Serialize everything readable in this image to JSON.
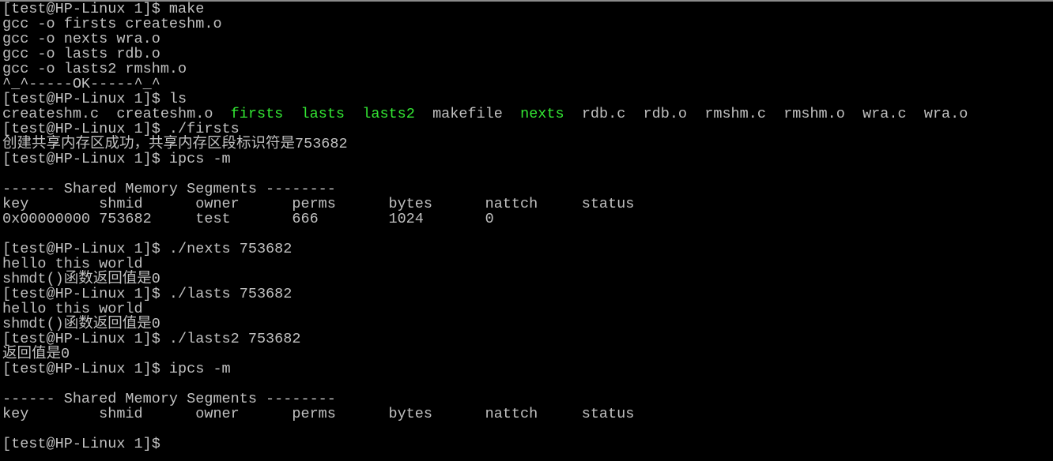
{
  "colors": {
    "background": "#000000",
    "text": "#c0c0c0",
    "executable": "#33e633"
  },
  "terminal": {
    "lines": [
      [
        {
          "t": "[test@HP-Linux 1]$ make"
        }
      ],
      [
        {
          "t": "gcc -o firsts createshm.o"
        }
      ],
      [
        {
          "t": "gcc -o nexts wra.o"
        }
      ],
      [
        {
          "t": "gcc -o lasts rdb.o"
        }
      ],
      [
        {
          "t": "gcc -o lasts2 rmshm.o"
        }
      ],
      [
        {
          "t": "^_^-----OK-----^_^"
        }
      ],
      [
        {
          "t": "[test@HP-Linux 1]$ ls"
        }
      ],
      [
        {
          "t": "createshm.c  createshm.o  "
        },
        {
          "t": "firsts",
          "c": "green"
        },
        {
          "t": "  "
        },
        {
          "t": "lasts",
          "c": "green"
        },
        {
          "t": "  "
        },
        {
          "t": "lasts2",
          "c": "green"
        },
        {
          "t": "  makefile  "
        },
        {
          "t": "nexts",
          "c": "green"
        },
        {
          "t": "  rdb.c  rdb.o  rmshm.c  rmshm.o  wra.c  wra.o"
        }
      ],
      [
        {
          "t": "[test@HP-Linux 1]$ ./firsts"
        }
      ],
      [
        {
          "t": "创建共享内存区成功，共享内存区段标识符是753682"
        }
      ],
      [
        {
          "t": "[test@HP-Linux 1]$ ipcs -m"
        }
      ],
      [
        {
          "t": ""
        }
      ],
      [
        {
          "t": "------ Shared Memory Segments --------"
        }
      ],
      [
        {
          "t": "key        shmid      owner      perms      bytes      nattch     status"
        }
      ],
      [
        {
          "t": "0x00000000 753682     test       666        1024       0"
        }
      ],
      [
        {
          "t": ""
        }
      ],
      [
        {
          "t": "[test@HP-Linux 1]$ ./nexts 753682"
        }
      ],
      [
        {
          "t": "hello this world"
        }
      ],
      [
        {
          "t": "shmdt()函数返回值是0"
        }
      ],
      [
        {
          "t": "[test@HP-Linux 1]$ ./lasts 753682"
        }
      ],
      [
        {
          "t": "hello this world"
        }
      ],
      [
        {
          "t": "shmdt()函数返回值是0"
        }
      ],
      [
        {
          "t": "[test@HP-Linux 1]$ ./lasts2 753682"
        }
      ],
      [
        {
          "t": "返回值是0"
        }
      ],
      [
        {
          "t": "[test@HP-Linux 1]$ ipcs -m"
        }
      ],
      [
        {
          "t": ""
        }
      ],
      [
        {
          "t": "------ Shared Memory Segments --------"
        }
      ],
      [
        {
          "t": "key        shmid      owner      perms      bytes      nattch     status"
        }
      ],
      [
        {
          "t": ""
        }
      ],
      [
        {
          "t": "[test@HP-Linux 1]$ "
        }
      ]
    ]
  }
}
